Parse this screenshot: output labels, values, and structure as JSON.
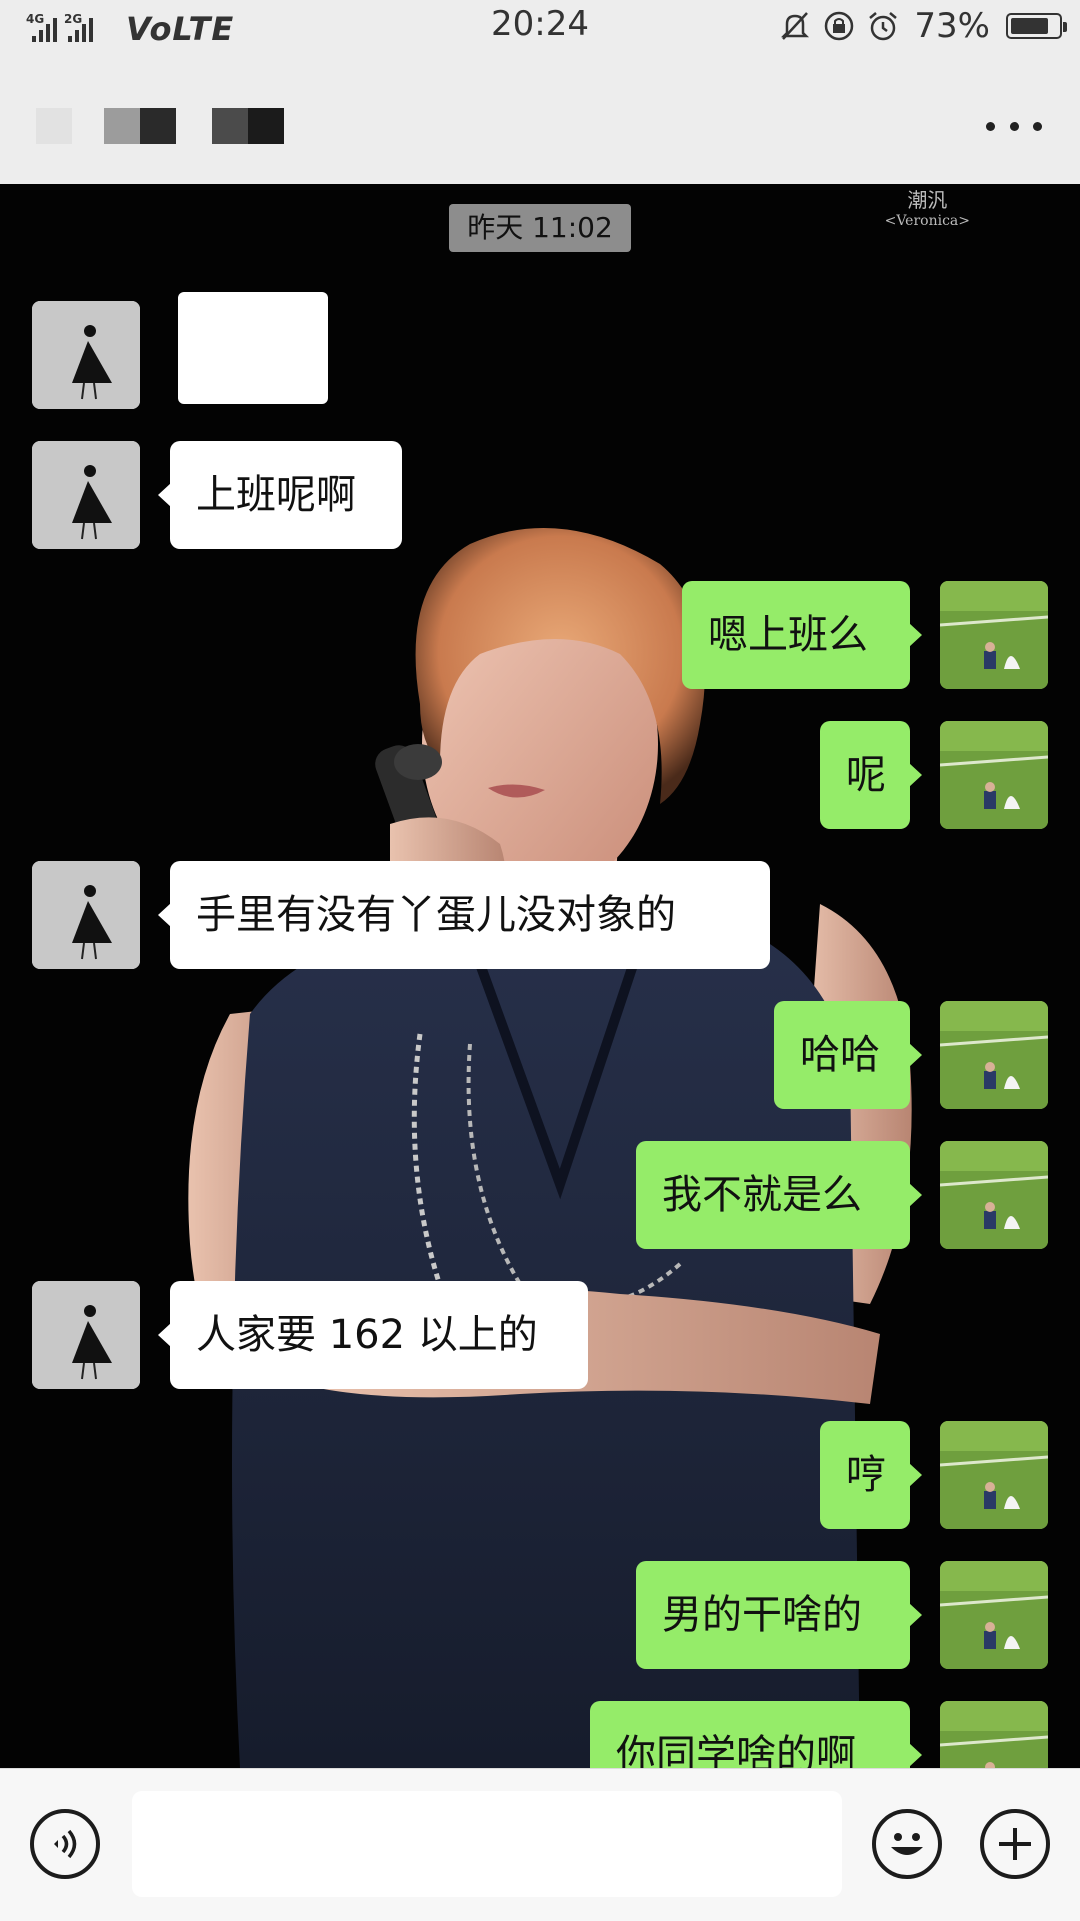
{
  "status_bar": {
    "net1": "4G",
    "net2": "2G",
    "volte": "VoLTE",
    "time": "20:24",
    "battery_percent": "73%",
    "battery_level": 0.73,
    "icons": [
      "signal-icon",
      "mute-icon",
      "orientation-lock-icon",
      "alarm-icon",
      "battery-icon"
    ]
  },
  "header": {
    "title_redacted": true,
    "more_icon": "more-dots-icon"
  },
  "chat": {
    "timestamp": "昨天 11:02",
    "watermark": {
      "line1": "潮汎",
      "line2": "<Veronica>"
    },
    "messages": [
      {
        "side": "in",
        "text": "",
        "redacted": true
      },
      {
        "side": "in",
        "text": "上班呢啊"
      },
      {
        "side": "out",
        "text": "嗯上班么"
      },
      {
        "side": "out",
        "text": "呢"
      },
      {
        "side": "in",
        "text": "手里有没有丫蛋儿没对象的"
      },
      {
        "side": "out",
        "text": "哈哈"
      },
      {
        "side": "out",
        "text": "我不就是么"
      },
      {
        "side": "in",
        "text": "人家要 162 以上的"
      },
      {
        "side": "out",
        "text": "哼"
      },
      {
        "side": "out",
        "text": "男的干啥的"
      },
      {
        "side": "out",
        "text": "你同学啥的啊"
      }
    ]
  },
  "input_bar": {
    "voice_icon": "voice-icon",
    "emoji_icon": "emoji-icon",
    "plus_icon": "plus-icon",
    "text_value": ""
  }
}
